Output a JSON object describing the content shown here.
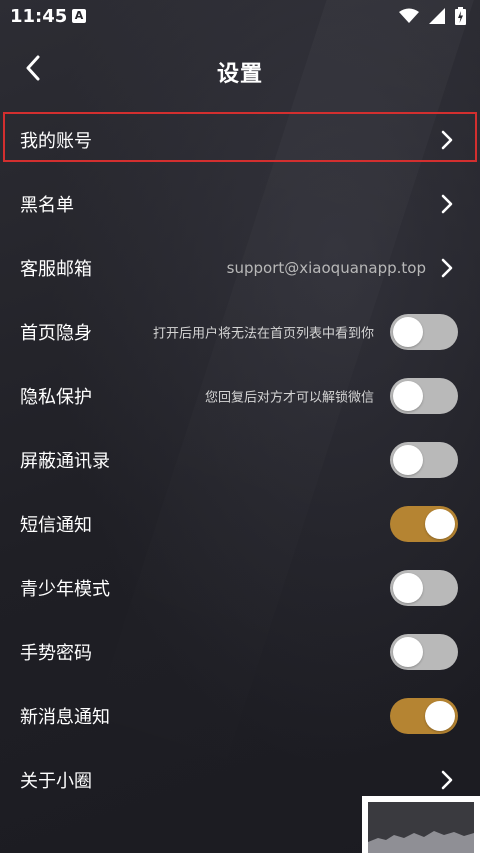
{
  "status_bar": {
    "time": "11:45",
    "app_icon_letter": "A",
    "icons": [
      "wifi-icon",
      "signal-icon",
      "battery-icon"
    ]
  },
  "header": {
    "title": "设置",
    "back_icon": "chevron-left-icon"
  },
  "rows": [
    {
      "label": "我的账号",
      "type": "link",
      "selected": true
    },
    {
      "label": "黑名单",
      "type": "link"
    },
    {
      "label": "客服邮箱",
      "type": "link",
      "value": "support@xiaoquanapp.top"
    },
    {
      "label": "首页隐身",
      "type": "toggle",
      "on": false,
      "hint": "打开后用户将无法在首页列表中看到你"
    },
    {
      "label": "隐私保护",
      "type": "toggle",
      "on": false,
      "hint": "您回复后对方才可以解锁微信"
    },
    {
      "label": "屏蔽通讯录",
      "type": "toggle",
      "on": false
    },
    {
      "label": "短信通知",
      "type": "toggle",
      "on": true
    },
    {
      "label": "青少年模式",
      "type": "toggle",
      "on": false
    },
    {
      "label": "手势密码",
      "type": "toggle",
      "on": false
    },
    {
      "label": "新消息通知",
      "type": "toggle",
      "on": true
    },
    {
      "label": "关于小圈",
      "type": "link"
    }
  ],
  "colors": {
    "toggle_on": "#b58432",
    "toggle_off": "#b9b9b9",
    "highlight": "#d32f2f",
    "background": "#25252b"
  }
}
